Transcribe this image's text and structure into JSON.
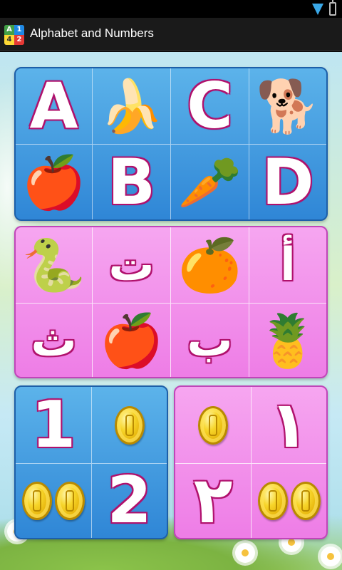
{
  "app": {
    "title": "Alphabet and Numbers",
    "icon_digits": [
      "A",
      "1",
      "4",
      "2"
    ]
  },
  "status_icons": [
    "wifi-icon",
    "battery-icon"
  ],
  "english_panel": {
    "letters": [
      "A",
      "C",
      "B",
      "D"
    ],
    "pictures": [
      "banana-icon",
      "dog-icon",
      "apple-icon",
      "carrot-icon"
    ]
  },
  "arabic_panel": {
    "letters": [
      "ت",
      "أ",
      "ث",
      "ب"
    ],
    "pictures": [
      "snake-icon",
      "orange-icon",
      "apple-icon",
      "pineapple-icon"
    ]
  },
  "english_numbers_panel": {
    "numbers": [
      "1",
      "2"
    ],
    "coin_counts": [
      1,
      2
    ]
  },
  "arabic_numbers_panel": {
    "numbers": [
      "١",
      "٢"
    ],
    "coin_counts": [
      1,
      2
    ]
  },
  "colors": {
    "blue_panel": "#2f86d6",
    "pink_panel": "#ee7de6",
    "glyph_outline": "#b0126d"
  }
}
